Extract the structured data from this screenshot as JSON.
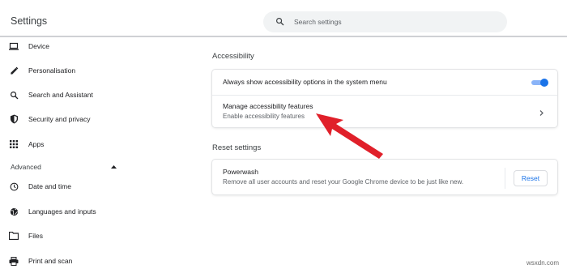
{
  "header": {
    "title": "Settings",
    "search_placeholder": "Search settings"
  },
  "sidebar": {
    "items": [
      {
        "label": "Device",
        "icon": "laptop-icon"
      },
      {
        "label": "Personalisation",
        "icon": "pencil-icon"
      },
      {
        "label": "Search and Assistant",
        "icon": "search-icon"
      },
      {
        "label": "Security and privacy",
        "icon": "shield-icon"
      },
      {
        "label": "Apps",
        "icon": "apps-grid-icon"
      }
    ],
    "advanced_label": "Advanced",
    "advanced_items": [
      {
        "label": "Date and time",
        "icon": "clock-icon"
      },
      {
        "label": "Languages and inputs",
        "icon": "globe-icon"
      },
      {
        "label": "Files",
        "icon": "folder-icon"
      },
      {
        "label": "Print and scan",
        "icon": "printer-icon"
      }
    ]
  },
  "accessibility": {
    "section_title": "Accessibility",
    "always_show_label": "Always show accessibility options in the system menu",
    "always_show_enabled": true,
    "manage_title": "Manage accessibility features",
    "manage_subtitle": "Enable accessibility features"
  },
  "reset": {
    "section_title": "Reset settings",
    "powerwash_title": "Powerwash",
    "powerwash_desc": "Remove all user accounts and reset your Google Chrome device to be just like new.",
    "button_label": "Reset"
  },
  "watermark": "wsxdn.com",
  "colors": {
    "accent": "#1a73e8",
    "annotation_arrow": "#e0202a"
  }
}
